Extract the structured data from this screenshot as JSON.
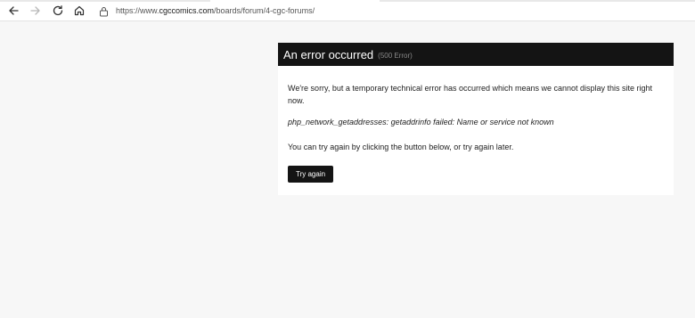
{
  "browser": {
    "url_prefix": "https://www.",
    "url_host": "cgccomics.com",
    "url_path": "/boards/forum/4-cgc-forums/"
  },
  "error": {
    "title": "An error occurred",
    "code": "(500 Error)",
    "message": "We're sorry, but a temporary technical error has occurred which means we cannot display this site right now.",
    "detail": "php_network_getaddresses: getaddrinfo failed: Name or service not known",
    "hint": "You can try again by clicking the button below, or try again later.",
    "button_label": "Try again"
  },
  "icons": {
    "back": "back-arrow-icon",
    "forward": "forward-arrow-icon",
    "reload": "reload-icon",
    "home": "home-icon",
    "lock": "lock-icon"
  },
  "colors": {
    "header_bg": "#141414",
    "page_bg": "#f7f7f7",
    "card_bg": "#ffffff"
  }
}
